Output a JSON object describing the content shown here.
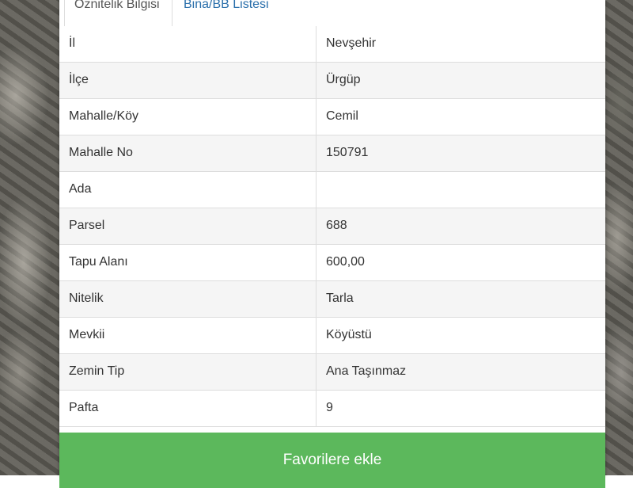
{
  "tabs": [
    {
      "label": "Öznitelik Bilgisi",
      "active": true
    },
    {
      "label": "Bina/BB Listesi",
      "active": false
    }
  ],
  "attributes": [
    {
      "key": "İl",
      "value": "Nevşehir"
    },
    {
      "key": "İlçe",
      "value": "Ürgüp"
    },
    {
      "key": "Mahalle/Köy",
      "value": "Cemil"
    },
    {
      "key": "Mahalle No",
      "value": "150791"
    },
    {
      "key": "Ada",
      "value": ""
    },
    {
      "key": "Parsel",
      "value": "688"
    },
    {
      "key": "Tapu Alanı",
      "value": "600,00"
    },
    {
      "key": "Nitelik",
      "value": "Tarla"
    },
    {
      "key": "Mevkii",
      "value": "Köyüstü"
    },
    {
      "key": "Zemin Tip",
      "value": "Ana Taşınmaz"
    },
    {
      "key": "Pafta",
      "value": "9"
    }
  ],
  "actions": {
    "favorite_label": "Favorilere ekle"
  },
  "colors": {
    "accent_green": "#5cb85c",
    "link_blue": "#2a6fab",
    "stripe": "#f5f5f5"
  }
}
